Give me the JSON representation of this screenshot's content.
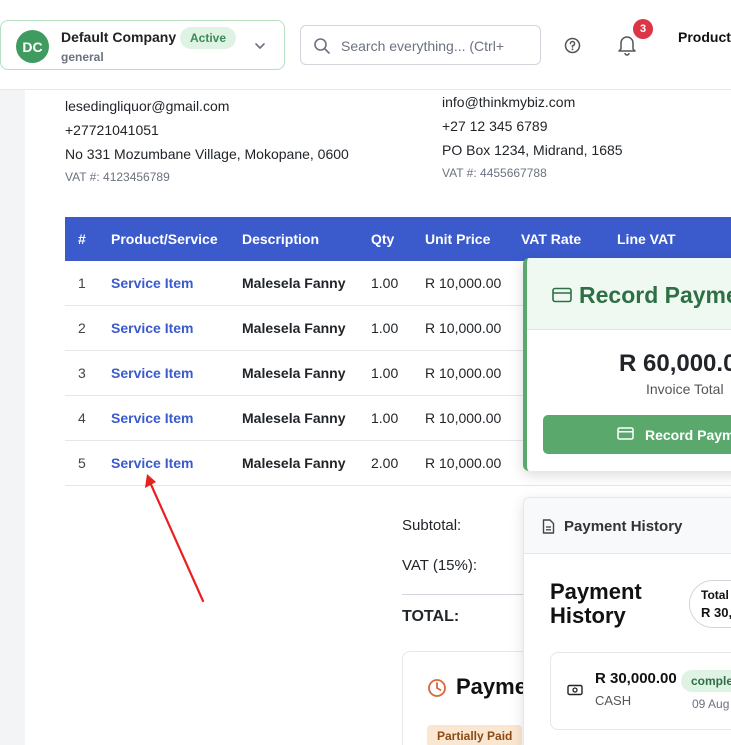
{
  "header": {
    "company": {
      "initials": "DC",
      "name": "Default Company",
      "status": "Active",
      "subtitle": "general"
    },
    "search": {
      "placeholder": "Search everything... (Ctrl+"
    },
    "notifications": {
      "count": "3"
    },
    "nav_label": "Production"
  },
  "seller": {
    "email": "lesedingliquor@gmail.com",
    "phone": "+27721041051",
    "address": "No 331 Mozumbane Village, Mokopane, 0600",
    "vat": "VAT #: 4123456789"
  },
  "buyer": {
    "email": "info@thinkmybiz.com",
    "phone": "+27 12 345 6789",
    "address": "PO Box 1234, Midrand, 1685",
    "vat": "VAT #: 4455667788"
  },
  "items_table": {
    "headers": [
      "#",
      "Product/Service",
      "Description",
      "Qty",
      "Unit Price",
      "VAT Rate",
      "Line VAT"
    ],
    "rows": [
      {
        "num": "1",
        "product": "Service Item",
        "description": "Malesela Fanny",
        "qty": "1.00",
        "unit_price": "R 10,000.00"
      },
      {
        "num": "2",
        "product": "Service Item",
        "description": "Malesela Fanny",
        "qty": "1.00",
        "unit_price": "R 10,000.00"
      },
      {
        "num": "3",
        "product": "Service Item",
        "description": "Malesela Fanny",
        "qty": "1.00",
        "unit_price": "R 10,000.00"
      },
      {
        "num": "4",
        "product": "Service Item",
        "description": "Malesela Fanny",
        "qty": "1.00",
        "unit_price": "R 10,000.00"
      },
      {
        "num": "5",
        "product": "Service Item",
        "description": "Malesela Fanny",
        "qty": "2.00",
        "unit_price": "R 10,000.00"
      }
    ]
  },
  "totals": {
    "subtotal_label": "Subtotal:",
    "vat_label": "VAT (15%):",
    "total_label": "TOTAL:"
  },
  "payment_card": {
    "title": "Payme",
    "status": "Partially Paid"
  },
  "record_payment": {
    "title": "Record Payme",
    "amount": "R 60,000.0",
    "amount_label": "Invoice Total",
    "button_label": "Record Paym"
  },
  "payment_history": {
    "header": "Payment History",
    "title": "Payment History",
    "total_label": "Total",
    "total_value": "R 30,0",
    "entry": {
      "amount": "R 30,000.00",
      "method": "CASH",
      "status": "complet",
      "date": "09 Aug"
    }
  },
  "colors": {
    "brand_blue": "#3b5bcc",
    "success_green": "#5aa86c",
    "danger_red": "#dc3545"
  }
}
